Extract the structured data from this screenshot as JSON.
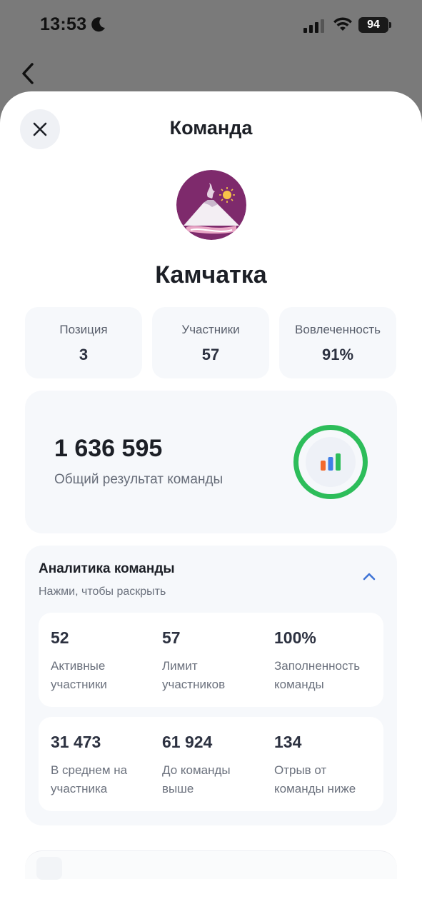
{
  "status_bar": {
    "time": "13:53",
    "battery": "94"
  },
  "sheet": {
    "title": "Команда"
  },
  "team": {
    "name": "Камчатка"
  },
  "stats": [
    {
      "label": "Позиция",
      "value": "3"
    },
    {
      "label": "Участники",
      "value": "57"
    },
    {
      "label": "Вовлеченность",
      "value": "91%"
    }
  ],
  "total": {
    "value": "1 636 595",
    "label": "Общий результат команды"
  },
  "analytics": {
    "title": "Аналитика команды",
    "subtitle": "Нажми, чтобы раскрыть",
    "metrics": [
      {
        "value": "52",
        "label": "Активные\nучастники"
      },
      {
        "value": "57",
        "label": "Лимит\nучастников"
      },
      {
        "value": "100%",
        "label": "Заполненность\nкоманды"
      },
      {
        "value": "31 473",
        "label": "В среднем на\nучастника"
      },
      {
        "value": "61 924",
        "label": "До команды\nвыше"
      },
      {
        "value": "134",
        "label": "Отрыв от\nкоманды ниже"
      }
    ]
  },
  "icons": {
    "back": "chevron-left-icon",
    "close": "close-icon",
    "collapse": "chevron-up-icon",
    "chart": "bar-chart-icon",
    "logo": "volcano-logo"
  },
  "colors": {
    "accent_green": "#2dbd5a",
    "logo_purple": "#7e2a6c",
    "chevron_blue": "#3f74d6",
    "bar_orange": "#f26a2e",
    "bar_blue": "#3f7fe6",
    "bar_green": "#2dbd5a"
  }
}
